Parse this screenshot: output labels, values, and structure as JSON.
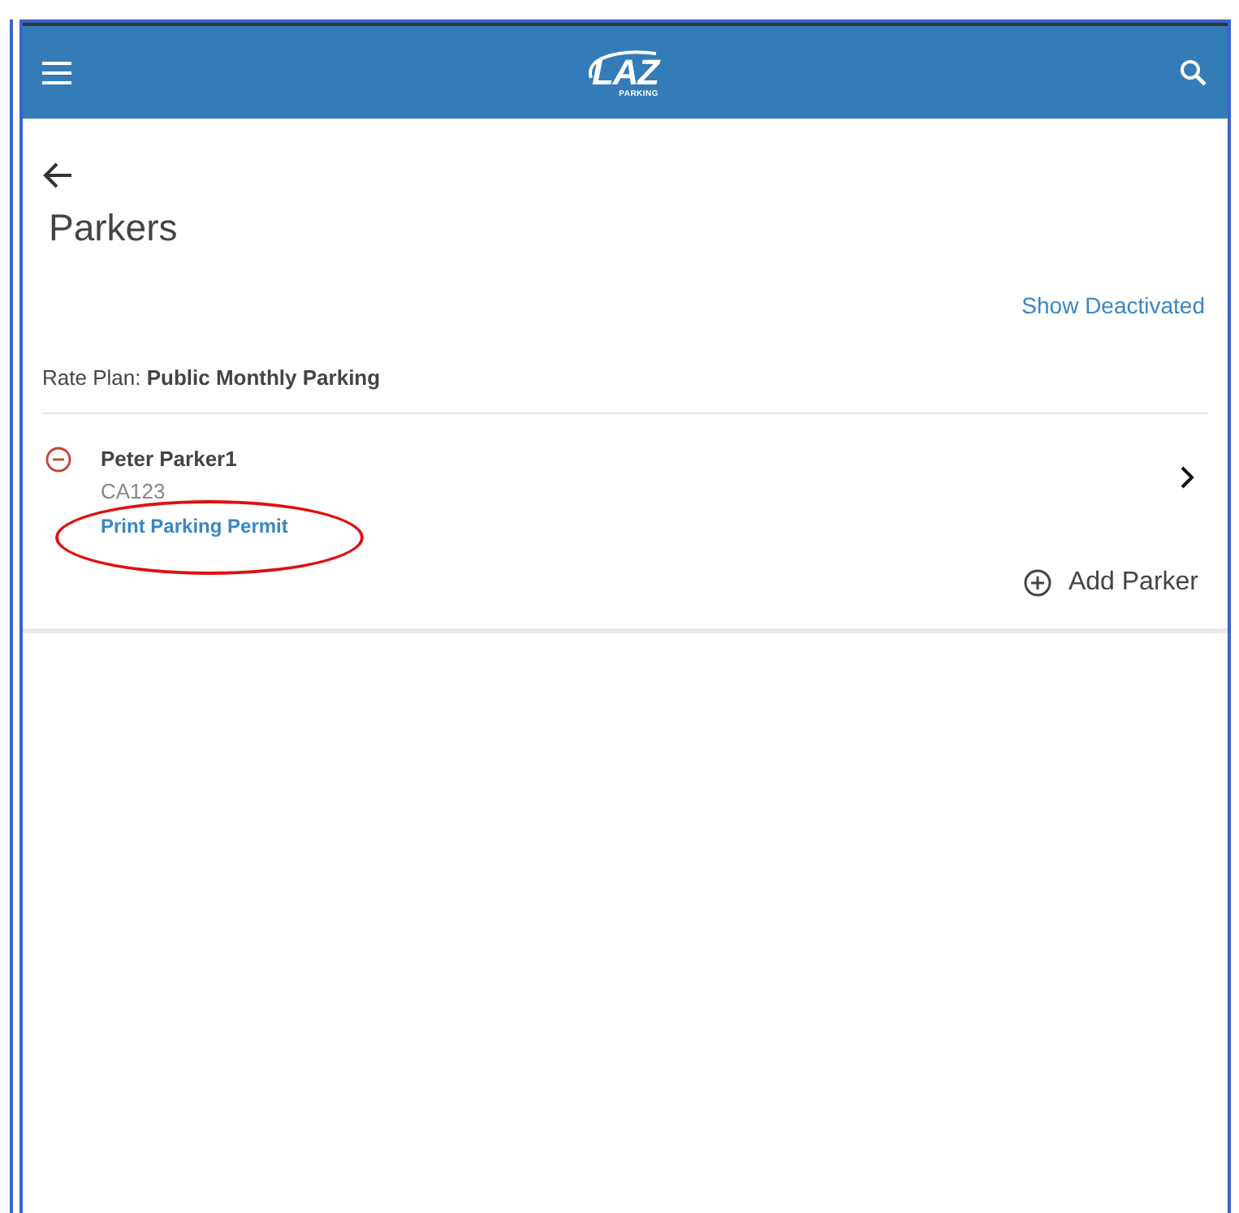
{
  "header": {
    "logo": {
      "text": "LAZ",
      "subtext": "PARKING"
    }
  },
  "page": {
    "title": "Parkers",
    "show_deactivated": "Show Deactivated"
  },
  "rate_plan": {
    "label": "Rate Plan:",
    "value": "Public Monthly Parking"
  },
  "parkers": [
    {
      "name": "Peter Parker1",
      "code": "CA123",
      "link": "Print Parking Permit",
      "highlighted": true
    }
  ],
  "add_button": "Add Parker"
}
